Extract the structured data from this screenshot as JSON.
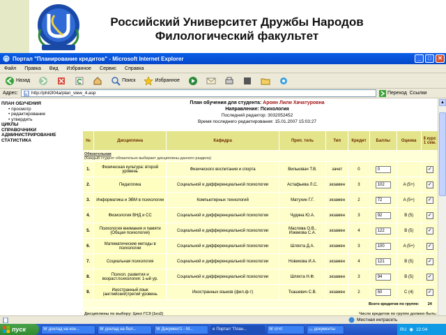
{
  "slide": {
    "title_line1": "Российский Университет Дружбы Народов",
    "title_line2": "Филологический факультет",
    "logo_text": "RUDN"
  },
  "window": {
    "title": "Портал \"Планирование кредитов\" - Microsoft Internet Explorer",
    "menu": [
      "Файл",
      "Правка",
      "Вид",
      "Избранное",
      "Сервис",
      "Справка"
    ],
    "toolbar": {
      "back": "Назад",
      "search": "Поиск",
      "favorites": "Избранное"
    },
    "address_label": "Адрес:",
    "address_value": "http://phil2l04a/plan_view_4.asp",
    "go_label": "Переход",
    "links_label": "Ссылки"
  },
  "side_menu": {
    "plan_label": "ПЛАН ОБУЧЕНИЯ",
    "sub": [
      "• просмотр",
      "• редактирование",
      "• утвердить"
    ],
    "items": [
      "ЦИКЛЫ",
      "СПРАВОЧНИКИ",
      "АДМИНИСТРИРОВАНИЕ",
      "СТАТИСТИКА"
    ]
  },
  "plan": {
    "title_prefix": "План обучения для студента:",
    "student": "Ароян Лили Хачатуровна",
    "direction_label": "Направление:",
    "direction": "Психология",
    "last_editor_label": "Последний редактор:",
    "last_editor": "3032052452",
    "last_edit_time_label": "Время последнего редактирования:",
    "last_edit_time": "15.01.2007 15:03:27"
  },
  "table": {
    "headers": [
      "№",
      "Дисциплина",
      "Кафедра",
      "Преп. тель",
      "Тип",
      "Кредит",
      "Баллы",
      "Оценка",
      "Ⅱ курс 1 сем."
    ],
    "section1_title": "Обязательная",
    "section1_note": "(Каждый студент обязательно выбирает дисциплины данного раздела)",
    "rows": [
      {
        "n": "1.",
        "disc": "Физическая культура: второй уровень",
        "dept": "Физического воспитания и спорта",
        "teacher": "Вильковач Т.В.",
        "type": "зачет",
        "credit": "0",
        "score": "0",
        "grade": ""
      },
      {
        "n": "2.",
        "disc": "Педагогика",
        "dept": "Социальной и дифференциальной психологии",
        "teacher": "Астафьева Л.С.",
        "type": "экзамен",
        "credit": "3",
        "score": "102",
        "grade": "A (5+)"
      },
      {
        "n": "3.",
        "disc": "Информатика и ЭВМ в психологии",
        "dept": "Компьютерных технологий",
        "teacher": "Матухин Г.Г.",
        "type": "экзамен",
        "credit": "2",
        "score": "72",
        "grade": "A (5+)"
      },
      {
        "n": "4.",
        "disc": "Физиология ВНД и СС",
        "dept": "Социальной и дифференциальной психологии",
        "teacher": "Чудина Ю.А.",
        "type": "экзамен",
        "credit": "3",
        "score": "92",
        "grade": "B (5)"
      },
      {
        "n": "5.",
        "disc": "Психология внимания и памяти (Общая психология)",
        "dept": "Социальной и дифференциальной психологии",
        "teacher": "Маслова О.В., Изюмова С.А.",
        "type": "экзамен",
        "credit": "4",
        "score": "122",
        "grade": "B (5)"
      },
      {
        "n": "6.",
        "disc": "Математические методы в психологии",
        "dept": "Социальной и дифференциальной психологии",
        "teacher": "Шляхта Д.А.",
        "type": "экзамен",
        "credit": "3",
        "score": "100",
        "grade": "A (5+)"
      },
      {
        "n": "7.",
        "disc": "Социальная психология",
        "dept": "Социальной и дифференциальной психологии",
        "teacher": "Новикова И.А.",
        "type": "экзамен",
        "credit": "4",
        "score": "121",
        "grade": "B (5)"
      },
      {
        "n": "8.",
        "disc": "Психол. развития и возраст.психология: 1-ый ур.",
        "dept": "Социальной и дифференциальной психологии",
        "teacher": "Шляхта Н.Ф.",
        "type": "экзамен",
        "credit": "3",
        "score": "94",
        "grade": "B (5)"
      },
      {
        "n": "9.",
        "disc": "Иностранный язык (английский)третий уровень",
        "dept": "Иностранных языков (фил.ф-т)",
        "teacher": "Ткашевич С.В.",
        "type": "экзамен",
        "credit": "2",
        "score": "50",
        "grade": "C (4)"
      }
    ],
    "total_label": "Всего кредитов по группе:",
    "total_value": "24",
    "section2_title": "Дисциплины по выбору: Цикл ГСЭ (1из2)",
    "section2_note": "Число кредитов по группе должно быть:"
  },
  "statusbar": {
    "zone": "Местная интрасеть"
  },
  "taskbar": {
    "start": "пуск",
    "tasks": [
      "доклад на кон...",
      "доклад на бол...",
      "Документ1 - M...",
      "Портал \"План...",
      "отчт"
    ],
    "folder": "документы",
    "lang": "RU",
    "time": "22:04"
  },
  "colors": {
    "header_row": "#e4e48a",
    "data_row": "#fefecb",
    "titlebar": "#0a5ee8",
    "taskbar": "#3168d5",
    "left_strip": "#e6e9c5"
  }
}
